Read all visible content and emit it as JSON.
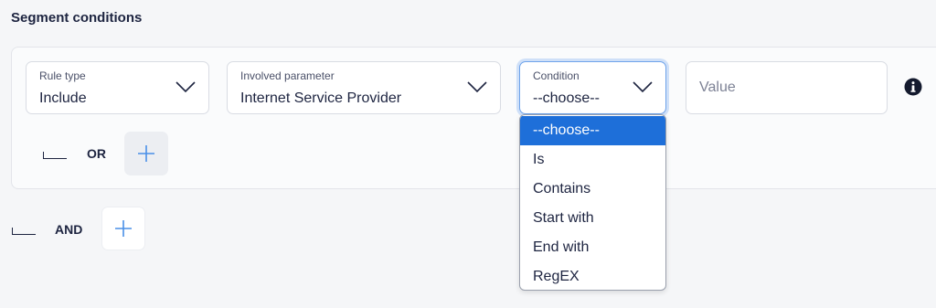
{
  "section": {
    "title": "Segment conditions"
  },
  "rule": {
    "rule_type": {
      "label": "Rule type",
      "value": "Include"
    },
    "involved_parameter": {
      "label": "Involved parameter",
      "value": "Internet Service Provider"
    },
    "condition": {
      "label": "Condition",
      "value": "--choose--"
    },
    "value": {
      "placeholder": "Value"
    },
    "or_label": "OR"
  },
  "and_label": "AND",
  "condition_options": [
    {
      "label": "--choose--",
      "selected": true
    },
    {
      "label": "Is",
      "selected": false
    },
    {
      "label": "Contains",
      "selected": false
    },
    {
      "label": "Start with",
      "selected": false
    },
    {
      "label": "End with",
      "selected": false
    },
    {
      "label": "RegEX",
      "selected": false
    }
  ],
  "icons": {
    "chevron": "chevron-down-icon",
    "info": "info-icon",
    "add": "plus-icon",
    "connector": "tree-connector-icon"
  },
  "colors": {
    "text": "#1d2440",
    "accent": "#1e6fd9",
    "focus_ring": "#6fa3ea",
    "plus": "#4a8fe7"
  }
}
